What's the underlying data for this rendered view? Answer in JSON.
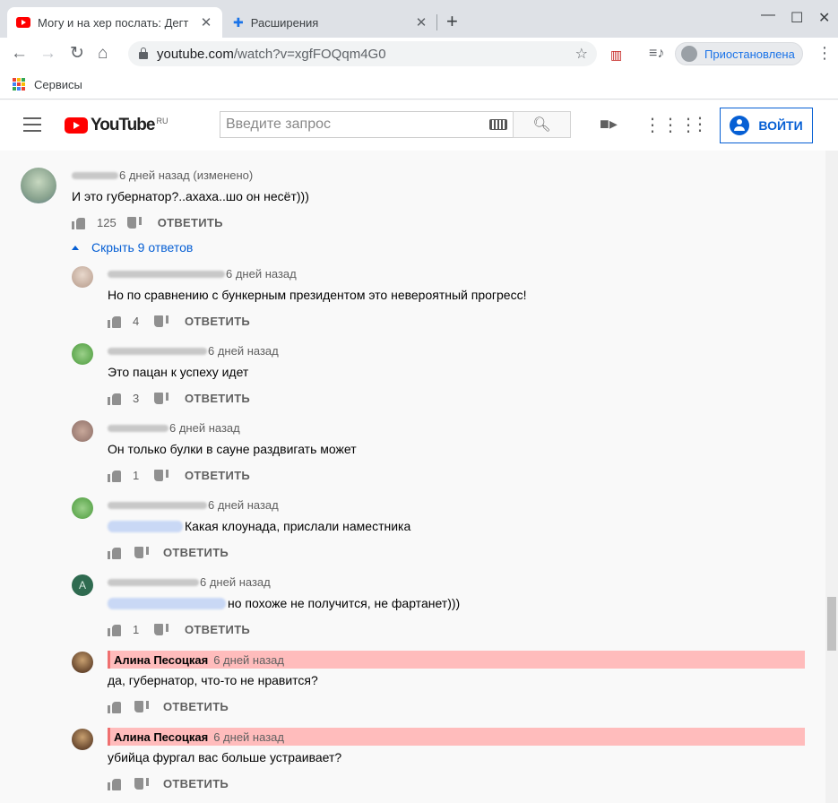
{
  "browser": {
    "tabs": [
      {
        "title": "Могу и на хер послать: Дегт",
        "active": true,
        "icon": "youtube-icon"
      },
      {
        "title": "Расширения",
        "active": false,
        "icon": "puzzle-icon"
      }
    ],
    "url_host": "youtube.com",
    "url_path": "/watch?v=xgfFOQqm4G0",
    "profile_label": "Приостановлена",
    "bookmark_label": "Сервисы"
  },
  "youtube": {
    "region": "RU",
    "logo_text": "YouTube",
    "search_placeholder": "Введите запрос",
    "signin_label": "ВОЙТИ"
  },
  "main_comment": {
    "time": "6 дней назад (изменено)",
    "text": "И это губернатор?..ахаха..шо он несёт)))",
    "likes": "125",
    "reply_label": "ОТВЕТИТЬ",
    "toggle_label": "Скрыть 9 ответов"
  },
  "replies": [
    {
      "time": "6 дней назад",
      "text": "Но по сравнению с бункерным президентом это невероятный прогресс!",
      "likes": "4"
    },
    {
      "time": "6 дней назад",
      "text": "Это пацан к успеху идет",
      "likes": "3"
    },
    {
      "time": "6 дней назад",
      "text": "Он только булки в сауне раздвигать может",
      "likes": "1"
    },
    {
      "time": "6 дней назад",
      "text": "Какая клоунада, прислали наместника",
      "likes": ""
    },
    {
      "time": "6 дней назад",
      "text": "но похоже не получится, не фартанет)))",
      "likes": "1"
    },
    {
      "author": "Алина Песоцкая",
      "time": "6 дней назад",
      "text": "да, губернатор, что-то не нравится?",
      "likes": ""
    },
    {
      "author": "Алина Песоцкая",
      "time": "6 дней назад",
      "text": "убийца фургал вас больше устраивает?",
      "likes": ""
    }
  ],
  "reply_label": "ОТВЕТИТЬ",
  "colors": {
    "accent": "#065fd4",
    "highlight": "#ffbcbc",
    "youtube_red": "#ff0000"
  }
}
